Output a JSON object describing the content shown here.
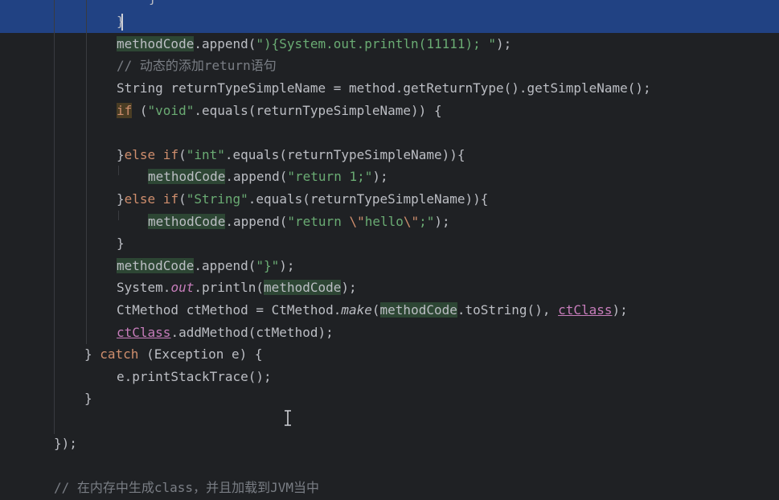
{
  "editor": {
    "theme_background": "#1f2124",
    "selection_color": "#214283",
    "lines": [
      {
        "id": "l0",
        "tokens": [
          {
            "t": "}",
            "c": "plain"
          }
        ]
      },
      {
        "id": "l1",
        "tokens": [
          {
            "t": "}",
            "c": "plain"
          }
        ]
      },
      {
        "id": "l2",
        "tokens": [
          {
            "t": "methodCode",
            "c": "plain hl"
          },
          {
            "t": ".append(",
            "c": "plain"
          },
          {
            "t": "\"){System.out.println(11111); \"",
            "c": "str"
          },
          {
            "t": ");",
            "c": "plain"
          }
        ]
      },
      {
        "id": "l3",
        "tokens": [
          {
            "t": "// 动态的添加return语句",
            "c": "cm"
          }
        ]
      },
      {
        "id": "l4",
        "tokens": [
          {
            "t": "String returnTypeSimpleName = method.getReturnType().getSimpleName();",
            "c": "plain"
          }
        ]
      },
      {
        "id": "l5",
        "tokens": [
          {
            "t": "if",
            "c": "kw if-hl"
          },
          {
            "t": " (",
            "c": "plain"
          },
          {
            "t": "\"void\"",
            "c": "str"
          },
          {
            "t": ".equals(returnTypeSimpleName)) {",
            "c": "plain"
          }
        ]
      },
      {
        "id": "l6",
        "tokens": []
      },
      {
        "id": "l7",
        "tokens": [
          {
            "t": "}",
            "c": "plain"
          },
          {
            "t": "else if",
            "c": "kw"
          },
          {
            "t": "(",
            "c": "plain"
          },
          {
            "t": "\"int\"",
            "c": "str"
          },
          {
            "t": ".equals(returnTypeSimpleName)){",
            "c": "plain"
          }
        ]
      },
      {
        "id": "l8",
        "tokens": [
          {
            "t": "methodCode",
            "c": "plain hl"
          },
          {
            "t": ".append(",
            "c": "plain"
          },
          {
            "t": "\"return 1;\"",
            "c": "str"
          },
          {
            "t": ");",
            "c": "plain"
          }
        ]
      },
      {
        "id": "l9",
        "tokens": [
          {
            "t": "}",
            "c": "plain"
          },
          {
            "t": "else if",
            "c": "kw"
          },
          {
            "t": "(",
            "c": "plain"
          },
          {
            "t": "\"String\"",
            "c": "str"
          },
          {
            "t": ".equals(returnTypeSimpleName)){",
            "c": "plain"
          }
        ]
      },
      {
        "id": "l10",
        "tokens": [
          {
            "t": "methodCode",
            "c": "plain hl"
          },
          {
            "t": ".append(",
            "c": "plain"
          },
          {
            "t": "\"return ",
            "c": "str"
          },
          {
            "t": "\\\"",
            "c": "kw"
          },
          {
            "t": "hello",
            "c": "str"
          },
          {
            "t": "\\\"",
            "c": "kw"
          },
          {
            "t": ";\"",
            "c": "str"
          },
          {
            "t": ");",
            "c": "plain"
          }
        ]
      },
      {
        "id": "l11",
        "tokens": [
          {
            "t": "}",
            "c": "plain"
          }
        ]
      },
      {
        "id": "l12",
        "tokens": [
          {
            "t": "methodCode",
            "c": "plain hl"
          },
          {
            "t": ".append(",
            "c": "plain"
          },
          {
            "t": "\"}\"",
            "c": "str"
          },
          {
            "t": ");",
            "c": "plain"
          }
        ]
      },
      {
        "id": "l13",
        "tokens": [
          {
            "t": "System.",
            "c": "plain"
          },
          {
            "t": "out",
            "c": "static-ital"
          },
          {
            "t": ".println(",
            "c": "plain"
          },
          {
            "t": "methodCode",
            "c": "plain hl"
          },
          {
            "t": ");",
            "c": "plain"
          }
        ]
      },
      {
        "id": "l14",
        "tokens": [
          {
            "t": "CtMethod ctMethod = CtMethod.",
            "c": "plain"
          },
          {
            "t": "make",
            "c": "plain ital"
          },
          {
            "t": "(",
            "c": "plain"
          },
          {
            "t": "methodCode",
            "c": "plain hl"
          },
          {
            "t": ".toString(), ",
            "c": "plain"
          },
          {
            "t": "ctClass",
            "c": "field"
          },
          {
            "t": ");",
            "c": "plain"
          }
        ]
      },
      {
        "id": "l15",
        "tokens": [
          {
            "t": "ctClass",
            "c": "field"
          },
          {
            "t": ".addMethod(ctMethod);",
            "c": "plain"
          }
        ]
      },
      {
        "id": "l16",
        "tokens": [
          {
            "t": "} ",
            "c": "plain"
          },
          {
            "t": "catch",
            "c": "kw"
          },
          {
            "t": " (Exception e) {",
            "c": "plain"
          }
        ]
      },
      {
        "id": "l17",
        "tokens": [
          {
            "t": "e.printStackTrace();",
            "c": "plain"
          }
        ]
      },
      {
        "id": "l18",
        "tokens": [
          {
            "t": "}",
            "c": "plain"
          }
        ]
      },
      {
        "id": "l19",
        "tokens": []
      },
      {
        "id": "l20",
        "tokens": [
          {
            "t": "});",
            "c": "plain"
          }
        ]
      },
      {
        "id": "l21",
        "tokens": []
      },
      {
        "id": "l22",
        "tokens": [
          {
            "t": "// 在内存中生成class，并且加载到JVM当中",
            "c": "cm"
          }
        ]
      }
    ]
  }
}
